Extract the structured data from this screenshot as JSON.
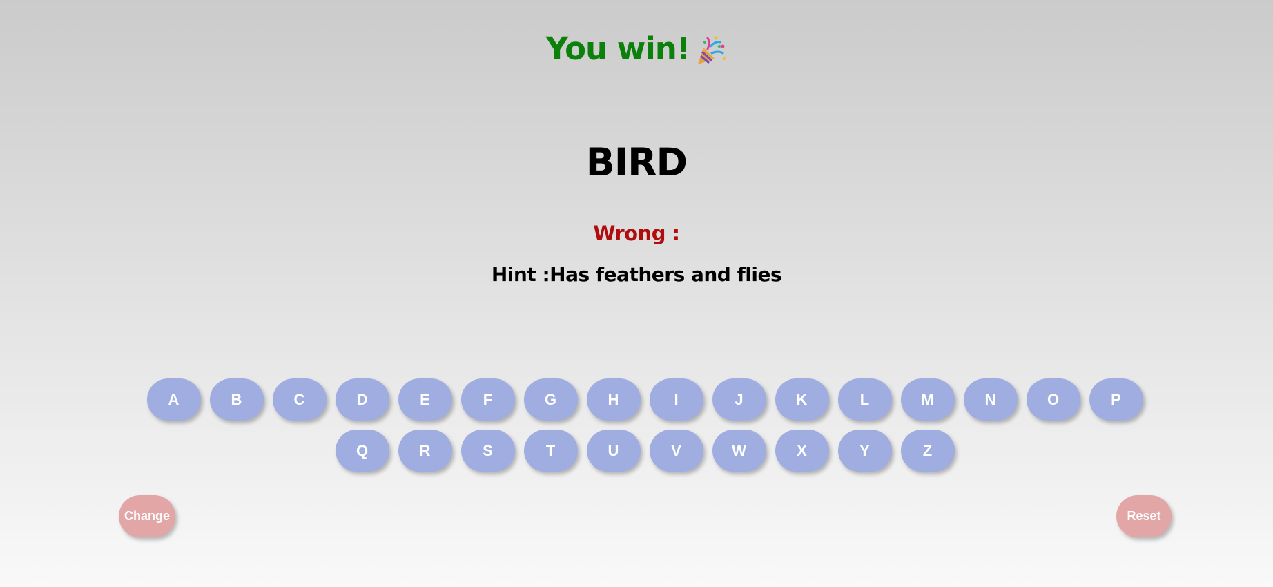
{
  "status": {
    "message": "You win!",
    "celebration_icon": "party-popper-icon",
    "color": "#0b800b"
  },
  "word": {
    "text": "BIRD"
  },
  "wrong": {
    "label": "Wrong :",
    "letters": "",
    "color": "#b10d0d"
  },
  "hint": {
    "text": "Hint :Has feathers and flies"
  },
  "keyboard": {
    "row1": [
      "A",
      "B",
      "C",
      "D",
      "E",
      "F",
      "G",
      "H",
      "I",
      "J",
      "K",
      "L",
      "M",
      "N",
      "O",
      "P"
    ],
    "row2": [
      "Q",
      "R",
      "S",
      "T",
      "U",
      "V",
      "W",
      "X",
      "Y",
      "Z"
    ],
    "key_color": "#a0ade1"
  },
  "controls": {
    "change_label": "Change",
    "reset_label": "Reset",
    "button_color": "#e3a6a7"
  }
}
